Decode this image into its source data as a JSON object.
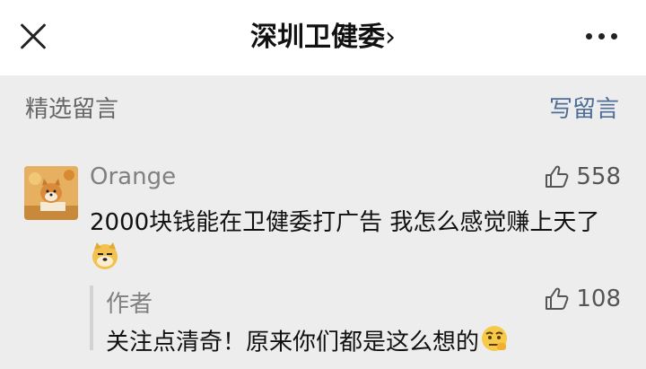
{
  "header": {
    "title": "深圳卫健委",
    "chevron": "›"
  },
  "section": {
    "title": "精选留言",
    "write_label": "写留言"
  },
  "comment": {
    "name": "Orange",
    "likes": "558",
    "text": "2000块钱能在卫健委打广告 我怎么感觉赚上天了"
  },
  "reply": {
    "name": "作者",
    "likes": "108",
    "text": "关注点清奇！原来你们都是这么想的"
  },
  "icons": {
    "close": "close-icon",
    "more": "more-icon",
    "like": "thumbs-up-icon"
  }
}
